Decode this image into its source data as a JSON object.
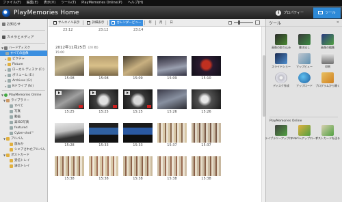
{
  "menubar": [
    "ファイル(F)",
    "編集(E)",
    "表示(V)",
    "ツール(T)",
    "PlayMemories Online(P)",
    "ヘルプ(H)"
  ],
  "app_title": "PlayMemories Home",
  "header": {
    "properties_label": "プロパティー",
    "tools_button": "ツール"
  },
  "sidebar": {
    "calendar_label": "お知らせ",
    "camera_label": "カメラとメディア",
    "hard_disk": "ハードディスク",
    "all_images": "すべての画像",
    "folders": [
      "ピクチャ",
      "Picture",
      "ローカル ディスク (C:)",
      "ボリューム (E:)",
      "Archives (G:)",
      "Nドライブ (N:)"
    ],
    "online_label": "PlayMemories Online",
    "library_label": "ライブラリー",
    "library_items": [
      "すべて",
      "写真",
      "動画",
      "高ISO写真",
      "featured",
      "Cyber-shot™"
    ],
    "album_label": "アルバム",
    "album_items": [
      "旅みか",
      "シェアされたアルバム"
    ],
    "postcard_label": "ポストカード",
    "postcard_items": [
      "受信トレイ",
      "送信トレイ"
    ]
  },
  "view_toolbar": {
    "thumbnail": "サムネイル表示",
    "detail": "詳細表示",
    "calendar": "カレンダービュー",
    "year": "年",
    "month": "月",
    "day": "日"
  },
  "content": {
    "prev_times": [
      "23:12",
      "23:12",
      "23:14"
    ],
    "date_heading": "2012年11月25日",
    "date_count": "(20 枚)",
    "time_label": "15:00",
    "rows": [
      [
        "15:08",
        "15:08",
        "15:09",
        "15:09",
        "15:10"
      ],
      [
        "15:25",
        "15:25",
        "15:25",
        "15:26",
        "15:26"
      ],
      [
        "15:28",
        "15:33",
        "15:33",
        "15:37",
        "15:37"
      ],
      [
        "15:38",
        "15:38",
        "15:38",
        "15:38",
        "15:38"
      ]
    ]
  },
  "tools": {
    "header": "ツール",
    "close": "✕",
    "items": [
      "画像の取り込み",
      "書き出し",
      "画像の編集",
      "スライドショー",
      "マップビュー",
      "印刷",
      "ディスク作成",
      "アップロード",
      "プログラムから開く"
    ],
    "online_header": "PlayMemories Online",
    "online_items": [
      "ライブラリーアップロード",
      "アルバムアップロード",
      "ポストカードを送る"
    ]
  }
}
